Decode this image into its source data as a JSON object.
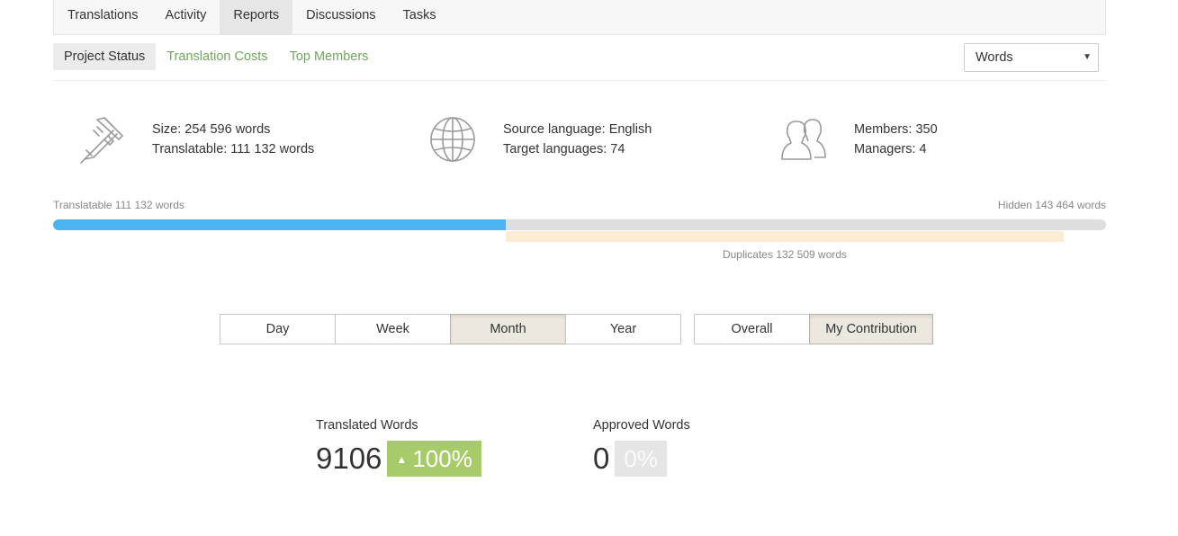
{
  "top_tabs": [
    "Translations",
    "Activity",
    "Reports",
    "Discussions",
    "Tasks"
  ],
  "sub_tabs": [
    "Project Status",
    "Translation Costs",
    "Top Members"
  ],
  "unit_select": {
    "value": "Words",
    "caret": "▼"
  },
  "stats": {
    "size": "Size: 254 596 words",
    "translatable": "Translatable: 111 132 words",
    "source_language": "Source language: English",
    "target_languages": "Target languages: 74",
    "members": "Members: 350",
    "managers": "Managers: 4",
    "icons": [
      "caliper-icon",
      "globe-icon",
      "members-icon"
    ]
  },
  "progress": {
    "translatable_label": "Translatable 111 132 words",
    "hidden_label": "Hidden 143 464 words",
    "duplicates_label": "Duplicates 132 509 words",
    "translatable_fraction": 0.43,
    "duplicates_fraction": 0.53,
    "colors": {
      "translatable": "#4ab3f1",
      "duplicates": "#fbedd2",
      "track": "#dedede"
    }
  },
  "period_buttons": [
    "Day",
    "Week",
    "Month",
    "Year"
  ],
  "period_active": "Month",
  "scope_buttons": [
    "Overall",
    "My Contribution"
  ],
  "scope_active": "My Contribution",
  "metrics": {
    "translated": {
      "label": "Translated Words",
      "value": "9106",
      "change": "100%",
      "arrow": "▲"
    },
    "approved": {
      "label": "Approved Words",
      "value": "0",
      "change": "0%"
    }
  },
  "colors": {
    "link_green": "#6fa85a",
    "badge_green": "#a8cb6a",
    "badge_gray": "#e5e5e5"
  }
}
